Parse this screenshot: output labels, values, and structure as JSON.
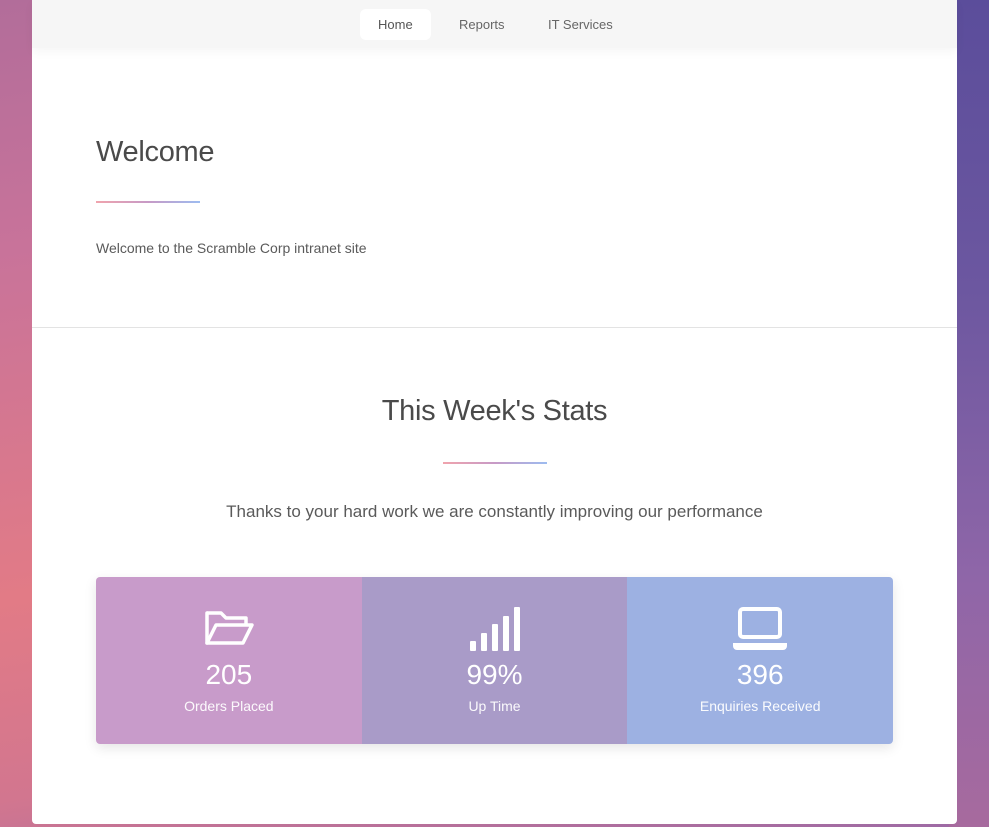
{
  "nav": {
    "items": [
      {
        "label": "Home",
        "active": true
      },
      {
        "label": "Reports",
        "active": false
      },
      {
        "label": "IT Services",
        "active": false
      }
    ]
  },
  "welcome": {
    "title": "Welcome",
    "text": "Welcome to the Scramble Corp intranet site"
  },
  "stats": {
    "title": "This Week's Stats",
    "subtitle": "Thanks to your hard work we are constantly improving our performance",
    "items": [
      {
        "icon": "folder-open-icon",
        "value": "205",
        "label": "Orders Placed",
        "color": "#c89bca"
      },
      {
        "icon": "signal-bars-icon",
        "value": "99%",
        "label": "Up Time",
        "color": "#a99bc8"
      },
      {
        "icon": "laptop-icon",
        "value": "396",
        "label": "Enquiries Received",
        "color": "#9db1e2"
      }
    ]
  },
  "colors": {
    "accent_gradient": [
      "#f0a4ad",
      "#c79ac6",
      "#9dbcf0"
    ],
    "text": "#4a4a4a"
  }
}
